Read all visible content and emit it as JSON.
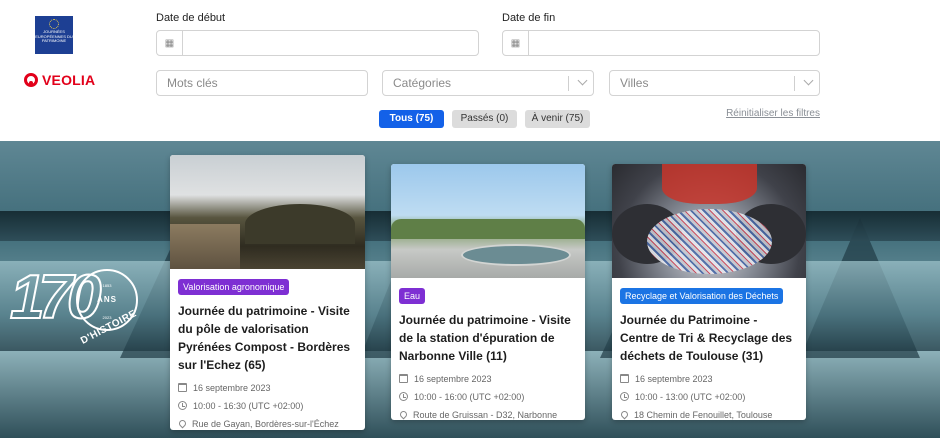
{
  "filters": {
    "start_date_label": "Date de début",
    "end_date_label": "Date de fin",
    "keywords_placeholder": "Mots clés",
    "categories_placeholder": "Catégories",
    "cities_placeholder": "Villes",
    "tabs": [
      {
        "label": "Tous (75)",
        "active": true
      },
      {
        "label": "Passés (0)",
        "active": false
      },
      {
        "label": "À venir (75)",
        "active": false
      }
    ],
    "reset_label": "Réinitialiser les filtres"
  },
  "logos": {
    "jep_text": "JOURNÉES EUROPÉENNES DU PATRIMOINE",
    "veolia_text": "VEOLIA"
  },
  "hero": {
    "anniversary_number": "170",
    "anniversary_unit": "ANS",
    "year_start": "1853",
    "year_end": "2023",
    "anniversary_caption": "D'HISTOIRE"
  },
  "events": [
    {
      "category": "Valorisation agronomique",
      "category_color": "#7e2fd3",
      "title": "Journée du patrimoine - Visite du pôle de valorisation Pyrénées Compost - Bordères sur l'Echez (65)",
      "date": "16 septembre 2023",
      "time": "10:00 - 16:30 (UTC +02:00)",
      "address": "Rue de Gayan, Bordères-sur-l'Échez"
    },
    {
      "category": "Eau",
      "category_color": "#7e2fd3",
      "title": "Journée du patrimoine - Visite de la station d'épuration de Narbonne Ville (11)",
      "date": "16 septembre 2023",
      "time": "10:00 - 16:00 (UTC +02:00)",
      "address": "Route de Gruissan - D32, Narbonne"
    },
    {
      "category": "Recyclage et Valorisation des Déchets",
      "category_color": "#1b74e4",
      "title": "Journée du Patrimoine - Centre de Tri & Recyclage des déchets de Toulouse (31)",
      "date": "16 septembre 2023",
      "time": "10:00 - 13:00 (UTC +02:00)",
      "address": "18 Chemin de Fenouillet, Toulouse"
    }
  ],
  "colors": {
    "primary": "#1361e8",
    "veolia_red": "#e2001a",
    "jep_blue": "#1d3f93"
  }
}
